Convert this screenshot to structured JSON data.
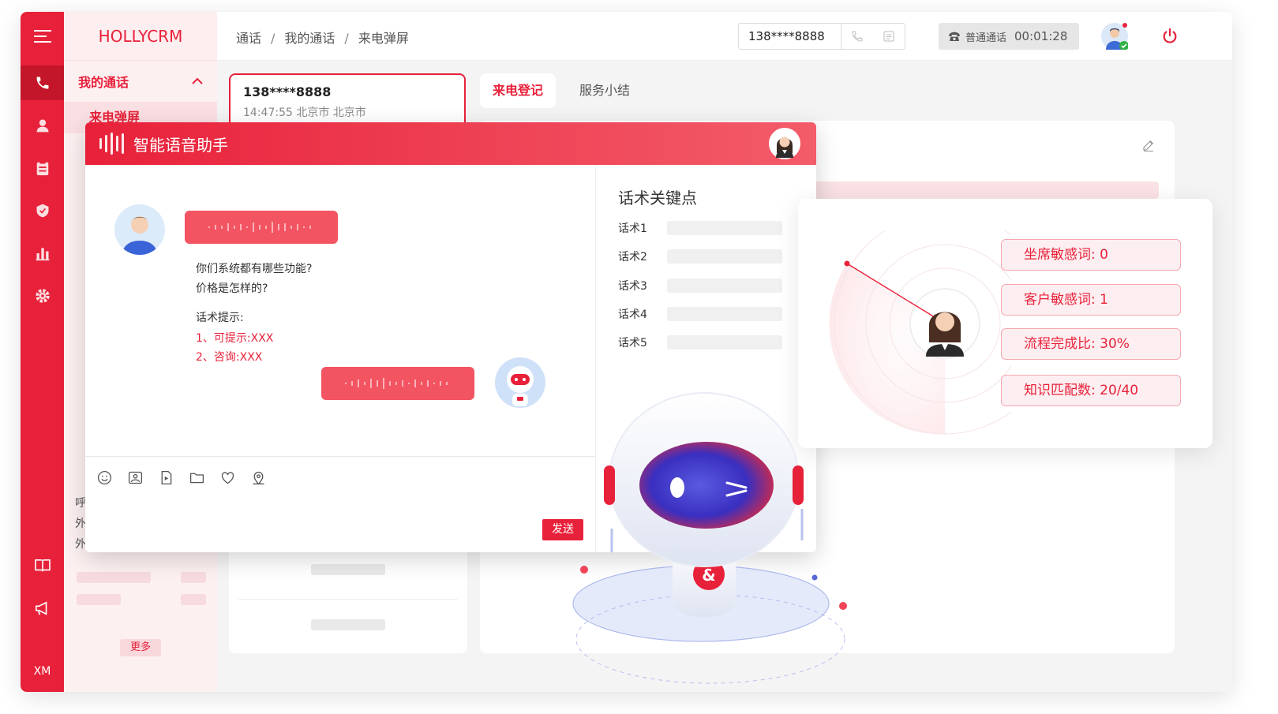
{
  "brand": "HOLLYCRM",
  "rail": {
    "bottom_label": "XM",
    "icons": [
      "menu-icon",
      "phone-icon",
      "user-icon",
      "clipboard-icon",
      "shield-icon",
      "bar-chart-icon",
      "gear-icon",
      "book-icon",
      "megaphone-icon"
    ]
  },
  "sidebar": {
    "group_label": "我的通话",
    "active_item": "来电弹屏",
    "partial_items": [
      "呼",
      "外",
      "外"
    ],
    "more_label": "更多"
  },
  "header": {
    "breadcrumb": [
      "通话",
      "我的通话",
      "来电弹屏"
    ],
    "breadcrumb_sep": "/",
    "phone_value": "138****8888",
    "call_type": "普通通话",
    "call_time": "00:01:28"
  },
  "caller": {
    "number": "138****8888",
    "meta": "14:47:55 北京市  北京市"
  },
  "tabs": {
    "active": "来电登记",
    "other": "服务小结"
  },
  "assistant": {
    "title": "智能语音助手",
    "customer_msg_line1": "你们系统都有哪些功能?",
    "customer_msg_line2": "价格是怎样的?",
    "hint_title": "话术提示:",
    "hint_1": "1、可提示:XXX",
    "hint_2": "2、咨询:XXX",
    "send_label": "发送",
    "keypoints_title": "话术关键点",
    "keypoints": [
      "话术1",
      "话术2",
      "话术3",
      "话术4",
      "话术5"
    ]
  },
  "stats": {
    "agent_sensitive": "坐席敏感词:  0",
    "customer_sensitive": "客户敏感词:  1",
    "flow_completion": "流程完成比:  30%",
    "knowledge_match": "知识匹配数:  20/40"
  },
  "colors": {
    "accent": "#e8213a",
    "accent_light": "#fdeff1",
    "rail_active": "#c4162b"
  }
}
